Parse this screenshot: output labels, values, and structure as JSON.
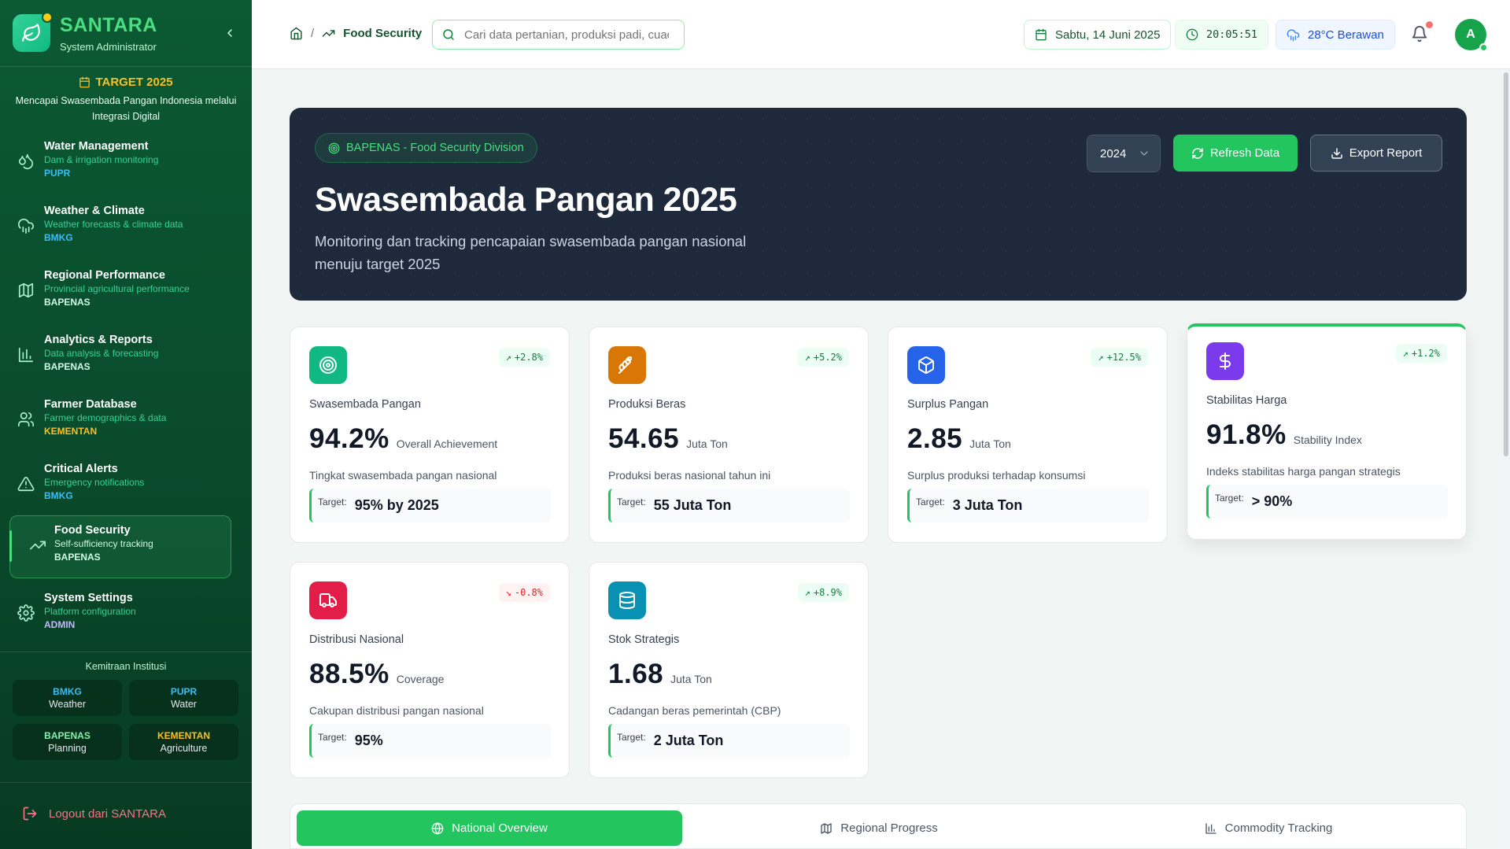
{
  "app": {
    "name": "SANTARA",
    "role": "System Administrator"
  },
  "target": {
    "title": "TARGET 2025",
    "text": "Mencapai Swasembada Pangan Indonesia melalui Integrasi Digital"
  },
  "nav": [
    {
      "title": "Water Management",
      "sub": "Dam & irrigation monitoring",
      "tag": "PUPR",
      "tag_color": "#38bdf8",
      "icon": "droplet-icon"
    },
    {
      "title": "Weather & Climate",
      "sub": "Weather forecasts & climate data",
      "tag": "BMKG",
      "tag_color": "#38bdf8",
      "icon": "cloud-rain-icon"
    },
    {
      "title": "Regional Performance",
      "sub": "Provincial agricultural performance",
      "tag": "BAPENAS",
      "tag_color": "#d1fae5",
      "icon": "map-icon"
    },
    {
      "title": "Analytics & Reports",
      "sub": "Data analysis & forecasting",
      "tag": "BAPENAS",
      "tag_color": "#d1fae5",
      "icon": "bar-chart-icon"
    },
    {
      "title": "Farmer Database",
      "sub": "Farmer demographics & data",
      "tag": "KEMENTAN",
      "tag_color": "#fbbf24",
      "icon": "users-icon"
    },
    {
      "title": "Critical Alerts",
      "sub": "Emergency notifications",
      "tag": "BMKG",
      "tag_color": "#38bdf8",
      "icon": "alert-triangle-icon"
    },
    {
      "title": "Food Security",
      "sub": "Self-sufficiency tracking",
      "tag": "BAPENAS",
      "tag_color": "#d1fae5",
      "icon": "trending-up-icon",
      "active": true
    },
    {
      "title": "System Settings",
      "sub": "Platform configuration",
      "tag": "ADMIN",
      "tag_color": "#c4b5fd",
      "icon": "gear-icon"
    }
  ],
  "partners": {
    "title": "Kemitraan Institusi",
    "items": [
      {
        "name": "BMKG",
        "desc": "Weather",
        "color": "#38bdf8"
      },
      {
        "name": "PUPR",
        "desc": "Water",
        "color": "#38bdf8"
      },
      {
        "name": "BAPENAS",
        "desc": "Planning",
        "color": "#86efac"
      },
      {
        "name": "KEMENTAN",
        "desc": "Agriculture",
        "color": "#fbbf24"
      }
    ]
  },
  "logout": "Logout dari SANTARA",
  "topbar": {
    "breadcrumb_current": "Food Security",
    "search_placeholder": "Cari data pertanian, produksi padi, cuaca...",
    "date": "Sabtu, 14 Juni 2025",
    "time": "20:05:51",
    "weather": "28°C Berawan",
    "avatar": "A"
  },
  "hero": {
    "chip": "BAPENAS - Food Security Division",
    "title": "Swasembada Pangan 2025",
    "subtitle": "Monitoring dan tracking pencapaian swasembada pangan nasional menuju target 2025",
    "year": "2024",
    "refresh": "Refresh Data",
    "export": "Export Report"
  },
  "cards": [
    {
      "label": "Swasembada Pangan",
      "value": "94.2%",
      "unit": "Overall Achievement",
      "desc": "Tingkat swasembada pangan nasional",
      "target_label": "Target:",
      "target": "95% by 2025",
      "trend": "+2.8%",
      "trend_dir": "up",
      "icon": "target-icon",
      "color": "#10b981"
    },
    {
      "label": "Produksi Beras",
      "value": "54.65",
      "unit": "Juta Ton",
      "desc": "Produksi beras nasional tahun ini",
      "target_label": "Target:",
      "target": "55 Juta Ton",
      "trend": "+5.2%",
      "trend_dir": "up",
      "icon": "wheat-icon",
      "color": "#d97706"
    },
    {
      "label": "Surplus Pangan",
      "value": "2.85",
      "unit": "Juta Ton",
      "desc": "Surplus produksi terhadap konsumsi",
      "target_label": "Target:",
      "target": "3 Juta Ton",
      "trend": "+12.5%",
      "trend_dir": "up",
      "icon": "package-icon",
      "color": "#2563eb"
    },
    {
      "label": "Stabilitas Harga",
      "value": "91.8%",
      "unit": "Stability Index",
      "desc": "Indeks stabilitas harga pangan strategis",
      "target_label": "Target:",
      "target": "> 90%",
      "trend": "+1.2%",
      "trend_dir": "up",
      "icon": "dollar-icon",
      "color": "#7c3aed"
    },
    {
      "label": "Distribusi Nasional",
      "value": "88.5%",
      "unit": "Coverage",
      "desc": "Cakupan distribusi pangan nasional",
      "target_label": "Target:",
      "target": "95%",
      "trend": "-0.8%",
      "trend_dir": "down",
      "icon": "truck-icon",
      "color": "#e11d48"
    },
    {
      "label": "Stok Strategis",
      "value": "1.68",
      "unit": "Juta Ton",
      "desc": "Cadangan beras pemerintah (CBP)",
      "target_label": "Target:",
      "target": "2 Juta Ton",
      "trend": "+8.9%",
      "trend_dir": "up",
      "icon": "database-icon",
      "color": "#0891b2"
    }
  ],
  "tabs": [
    {
      "label": "National Overview",
      "icon": "globe-icon",
      "active": true
    },
    {
      "label": "Regional Progress",
      "icon": "map-icon"
    },
    {
      "label": "Commodity Tracking",
      "icon": "bar-chart-icon"
    }
  ]
}
